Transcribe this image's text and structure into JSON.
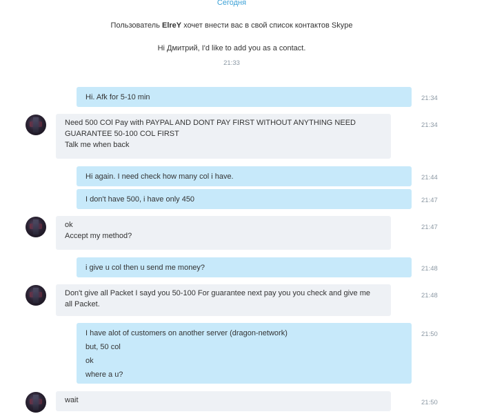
{
  "header": {
    "day": "Сегодня"
  },
  "system": {
    "prefix": "Пользователь ",
    "user": "ElreY",
    "suffix": " хочет внести вас в свой список контактов Skype",
    "greeting": "Hi Дмитрий, I'd like to add you as a contact.",
    "time": "21:33"
  },
  "messages": [
    {
      "dir": "out",
      "time": "21:34",
      "lines": [
        "Hi. Afk for 5-10 min"
      ]
    },
    {
      "dir": "in",
      "time": "21:34",
      "lines": [
        "Need 500 COl Pay with PAYPAL AND DONT PAY FIRST WITHOUT ANYTHING NEED",
        "GUARANTEE 50-100 COL FIRST",
        "Talk me when back"
      ]
    },
    {
      "dir": "out",
      "time": "21:44",
      "lines": [
        "Hi again. I need check how many col i have."
      ]
    },
    {
      "dir": "out",
      "time": "21:47",
      "lines": [
        "I don't have 500, i have only 450"
      ]
    },
    {
      "dir": "in",
      "time": "21:47",
      "lines": [
        "ok",
        "Accept my method?"
      ]
    },
    {
      "dir": "out",
      "time": "21:48",
      "lines": [
        "i give u col then u send me money?"
      ]
    },
    {
      "dir": "in",
      "time": "21:48",
      "lines": [
        "Don't give all Packet I sayd you 50-100 For guarantee next pay you you check and give me",
        "all Packet."
      ]
    },
    {
      "dir": "out",
      "time": "21:50",
      "lines": [
        "I have alot of customers on another server (dragon-network)",
        "but, 50 col",
        "ok",
        "where a u?"
      ]
    },
    {
      "dir": "in",
      "time": "21:50",
      "lines": [
        "wait"
      ]
    }
  ]
}
